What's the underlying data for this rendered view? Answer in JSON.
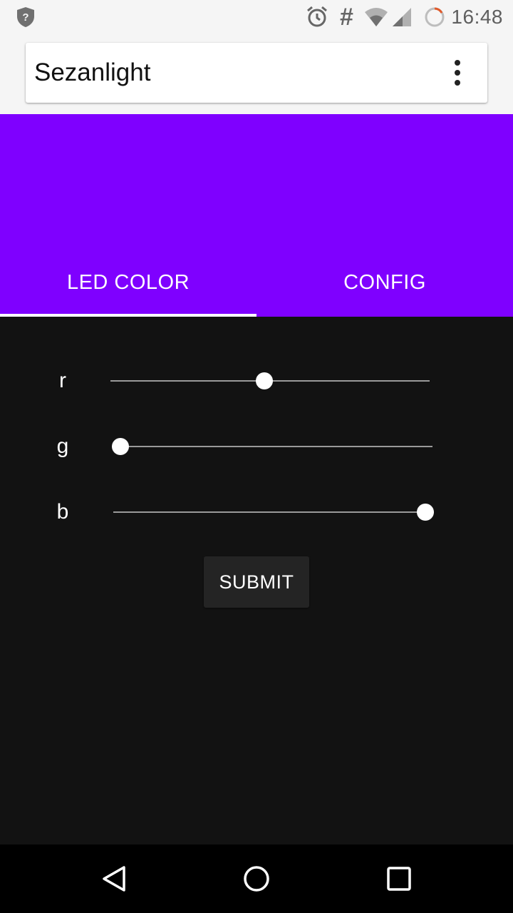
{
  "status_bar": {
    "time": "16:48",
    "icons": [
      "shield-question-icon",
      "alarm-icon",
      "hash-icon",
      "wifi-icon",
      "cell-signal-icon",
      "sync-progress-icon"
    ]
  },
  "app_bar": {
    "title": "Sezanlight",
    "menu_icon": "more-vert-icon"
  },
  "tabs": [
    {
      "label": "LED COLOR",
      "active": true
    },
    {
      "label": "CONFIG",
      "active": false
    }
  ],
  "sliders": [
    {
      "label": "r",
      "value": 0.48
    },
    {
      "label": "g",
      "value": 0.0
    },
    {
      "label": "b",
      "value": 1.0
    }
  ],
  "submit_label": "SUBMIT",
  "colors": {
    "header": "#7f00ff",
    "content_bg": "#121212",
    "nav_bg": "#000000"
  },
  "nav_bar": {
    "icons": [
      "back-icon",
      "home-icon",
      "recents-icon"
    ]
  }
}
